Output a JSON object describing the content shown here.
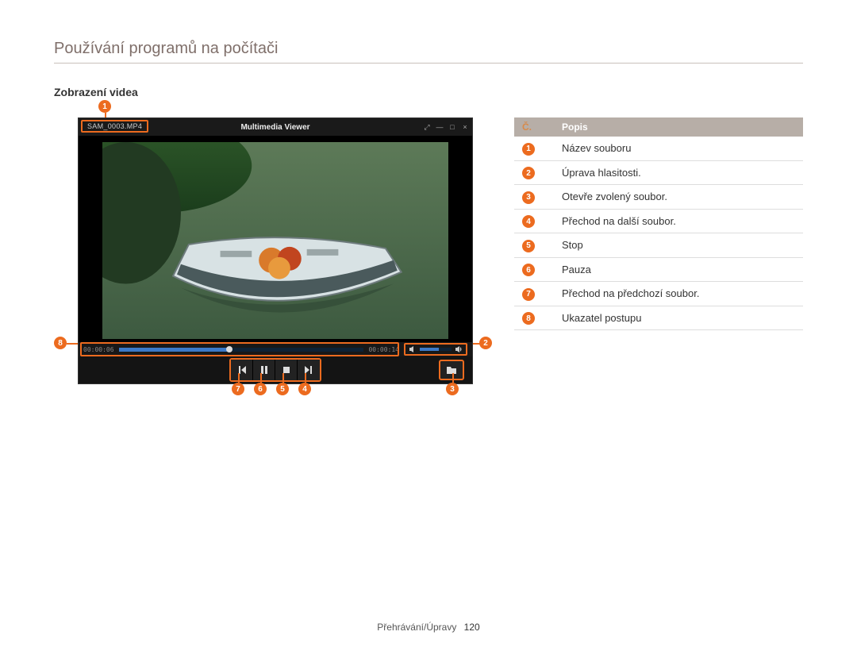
{
  "section_title": "Používání programů na počítači",
  "subheading": "Zobrazení videa",
  "player": {
    "app_title": "Multimedia Viewer",
    "filename": "SAM_0003.MP4",
    "time_elapsed": "00:00:06",
    "time_total": "00:00:14"
  },
  "callouts": [
    "1",
    "2",
    "3",
    "4",
    "5",
    "6",
    "7",
    "8"
  ],
  "table": {
    "header_num": "Č.",
    "header_desc": "Popis",
    "rows": [
      {
        "n": "1",
        "desc": "Název souboru"
      },
      {
        "n": "2",
        "desc": "Úprava hlasitosti."
      },
      {
        "n": "3",
        "desc": "Otevře zvolený soubor."
      },
      {
        "n": "4",
        "desc": "Přechod na další soubor."
      },
      {
        "n": "5",
        "desc": "Stop"
      },
      {
        "n": "6",
        "desc": "Pauza"
      },
      {
        "n": "7",
        "desc": "Přechod na předchozí soubor."
      },
      {
        "n": "8",
        "desc": "Ukazatel postupu"
      }
    ]
  },
  "footer": {
    "path": "Přehrávání/Úpravy",
    "page": "120"
  }
}
